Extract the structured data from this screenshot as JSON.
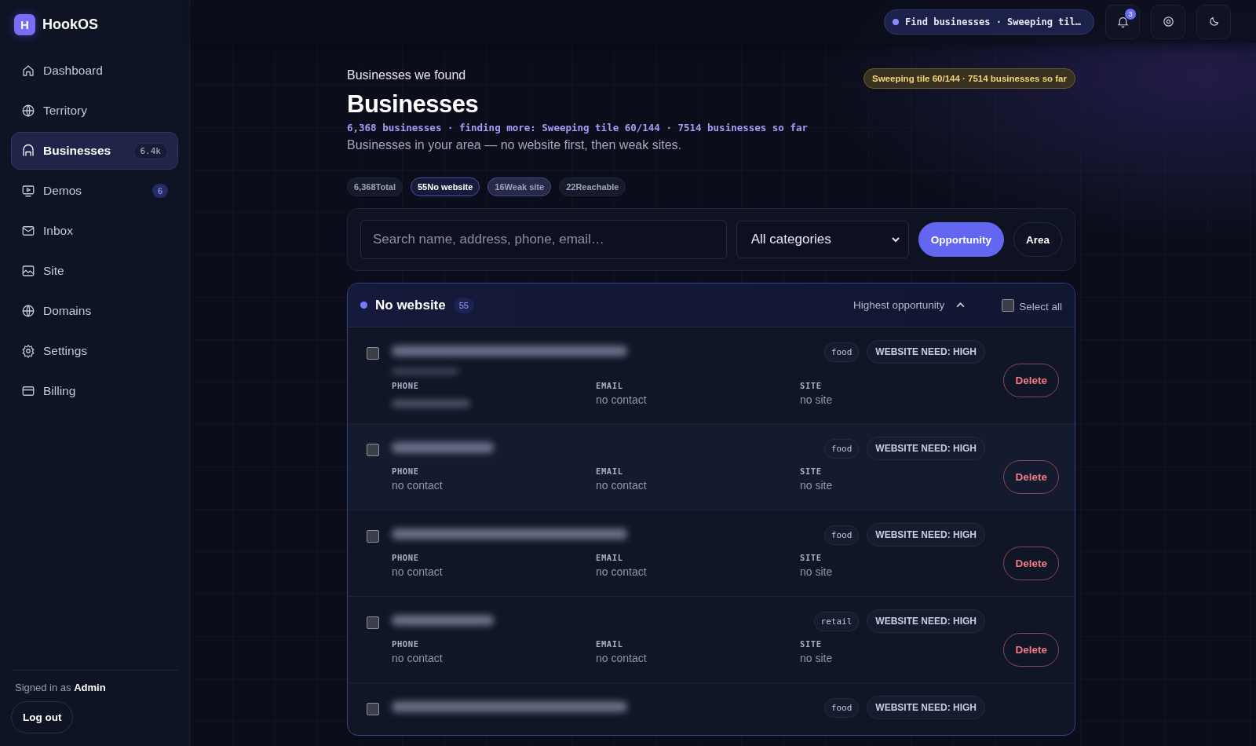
{
  "app": {
    "logo_letter": "H",
    "name": "HookOS"
  },
  "sidebar": {
    "items": [
      {
        "label": "Dashboard",
        "selected": false
      },
      {
        "label": "Territory",
        "selected": false
      },
      {
        "label": "Businesses",
        "selected": true,
        "badge": "6.4k"
      },
      {
        "label": "Demos",
        "selected": false,
        "badge": "6"
      },
      {
        "label": "Inbox",
        "selected": false
      },
      {
        "label": "Site",
        "selected": false
      },
      {
        "label": "Domains",
        "selected": false
      },
      {
        "label": "Settings",
        "selected": false
      },
      {
        "label": "Billing",
        "selected": false
      }
    ],
    "signed_in": "Signed in as **Admin**",
    "logout": "Log out"
  },
  "topbar": {
    "job": "Find businesses · Sweeping til…",
    "notifications": "3"
  },
  "header": {
    "eyebrow": "Businesses we found",
    "title": "Businesses",
    "progress_pill": "Sweeping tile 60/144 · 7514 businesses so far",
    "status_line": "6,368 businesses · finding more: Sweeping tile 60/144 · 7514 businesses so far",
    "subtitle": "Businesses in your area — no website first, then weak sites."
  },
  "stats": [
    {
      "count": "6,368",
      "label": "Total",
      "selected": false
    },
    {
      "count": "55",
      "label": "No website",
      "selected": true
    },
    {
      "count": "16",
      "label": "Weak site",
      "selected": false
    },
    {
      "count": "22",
      "label": "Reachable",
      "selected": false
    }
  ],
  "filters": {
    "search_placeholder": "Search name, address, phone, email…",
    "category": "All categories",
    "modes": [
      {
        "label": "Opportunity",
        "selected": true
      },
      {
        "label": "Area",
        "selected": false
      }
    ]
  },
  "group": {
    "title": "No website",
    "count": "55",
    "sort": "Highest opportunity",
    "select_all": {
      "label": "Select all",
      "checked": false
    },
    "rows": [
      {
        "checked": false,
        "name": {
          "kind": "blurred"
        },
        "address": {
          "kind": "blurred"
        },
        "tag": "food",
        "need": "WEBSITE NEED: HIGH",
        "delete": "Delete",
        "fields": [
          {
            "label": "PHONE",
            "value": {
              "kind": "blurred"
            }
          },
          {
            "label": "EMAIL",
            "value": {
              "kind": "text",
              "text": "no contact"
            }
          },
          {
            "label": "SITE",
            "value": {
              "kind": "text",
              "text": "no site"
            }
          }
        ]
      },
      {
        "checked": false,
        "name": {
          "kind": "blurred"
        },
        "tag": "food",
        "need": "WEBSITE NEED: HIGH",
        "delete": "Delete",
        "fields": [
          {
            "label": "PHONE",
            "value": {
              "kind": "text",
              "text": "no contact"
            }
          },
          {
            "label": "EMAIL",
            "value": {
              "kind": "text",
              "text": "no contact"
            }
          },
          {
            "label": "SITE",
            "value": {
              "kind": "text",
              "text": "no site"
            }
          }
        ]
      },
      {
        "checked": false,
        "name": {
          "kind": "blurred"
        },
        "tag": "food",
        "need": "WEBSITE NEED: HIGH",
        "delete": "Delete",
        "fields": [
          {
            "label": "PHONE",
            "value": {
              "kind": "text",
              "text": "no contact"
            }
          },
          {
            "label": "EMAIL",
            "value": {
              "kind": "text",
              "text": "no contact"
            }
          },
          {
            "label": "SITE",
            "value": {
              "kind": "text",
              "text": "no site"
            }
          }
        ]
      },
      {
        "checked": false,
        "name": {
          "kind": "blurred"
        },
        "tag": "retail",
        "need": "WEBSITE NEED: HIGH",
        "delete": "Delete",
        "fields": [
          {
            "label": "PHONE",
            "value": {
              "kind": "text",
              "text": "no contact"
            }
          },
          {
            "label": "EMAIL",
            "value": {
              "kind": "text",
              "text": "no contact"
            }
          },
          {
            "label": "SITE",
            "value": {
              "kind": "text",
              "text": "no site"
            }
          }
        ]
      },
      {
        "checked": false,
        "name": {
          "kind": "blurred"
        },
        "tag": "food",
        "need": "WEBSITE NEED: HIGH"
      }
    ]
  }
}
